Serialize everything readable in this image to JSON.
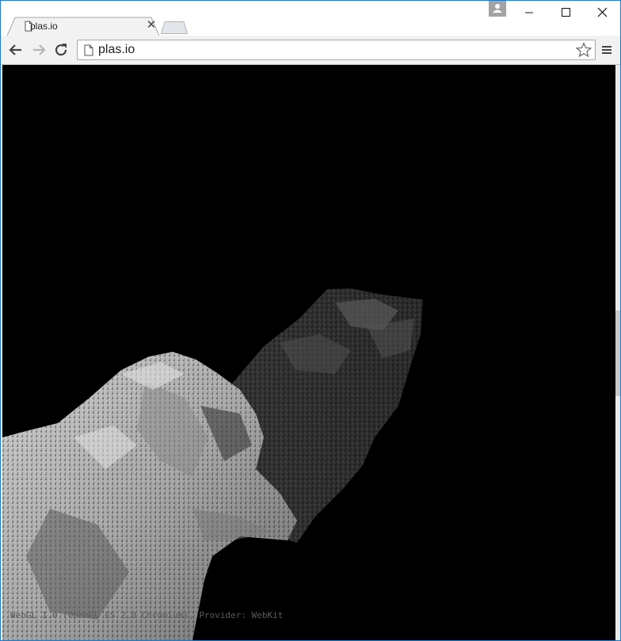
{
  "browser": {
    "tab": {
      "title": "plas.io",
      "close_glyph": "✕",
      "favicon": "page-icon"
    },
    "address_bar": {
      "url": "plas.io"
    },
    "window_controls": {
      "minimize": "—",
      "maximize": "☐",
      "close": "✕"
    },
    "icons": {
      "back": "back-arrow-icon",
      "forward": "forward-arrow-icon",
      "reload": "reload-icon",
      "bookmark": "star-icon",
      "menu": "hamburger-menu-icon",
      "profile": "profile-icon"
    },
    "accent": "#1f7ac9"
  },
  "page": {
    "background": "#000000",
    "status_text": "WebGL 1.0 (OpenGL ES 2.0 Chromium), Provider: WebKit"
  }
}
